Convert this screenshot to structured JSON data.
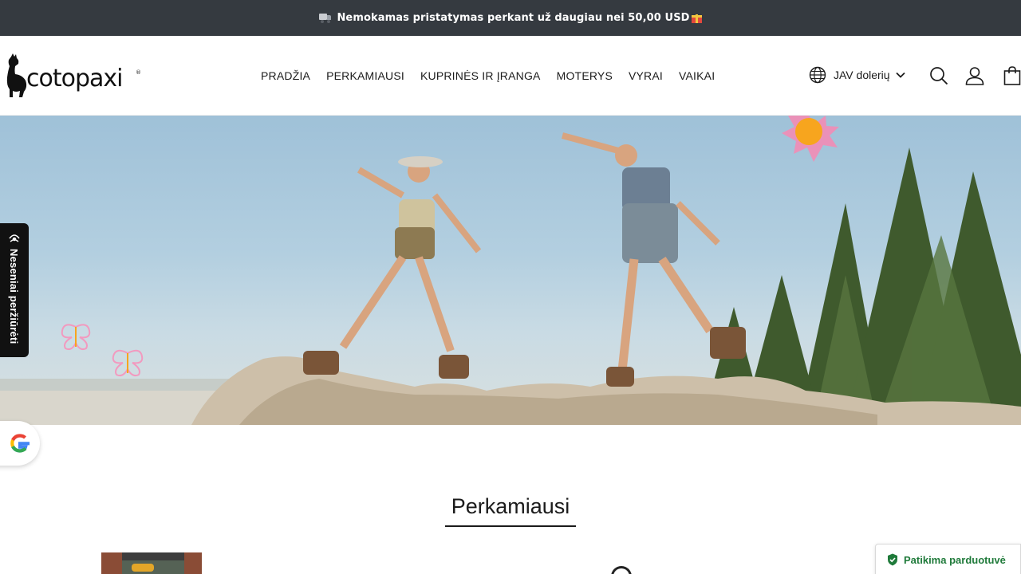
{
  "announcement": {
    "text": "Nemokamas pristatymas perkant už daugiau nei 50,00 USD"
  },
  "brand": {
    "name": "cotopaxi",
    "registered": "®"
  },
  "nav": {
    "items": [
      "PRADŽIA",
      "PERKAMIAUSI",
      "KUPRINĖS IR ĮRANGA",
      "MOTERYS",
      "VYRAI",
      "VAIKAI"
    ]
  },
  "currency": {
    "label": "JAV dolerių"
  },
  "recently_viewed": {
    "label": "Neseniai peržiūrėti"
  },
  "section": {
    "title": "Perkamiausi"
  },
  "trust_badge": {
    "label": "Patikima parduotuvė"
  },
  "colors": {
    "announce_bg": "#353a40",
    "trusted_green": "#1f7a3a",
    "text": "#1b1b1b"
  },
  "icons": [
    "truck-icon",
    "gift-icon",
    "globe-icon",
    "chevron-down-icon",
    "search-icon",
    "account-icon",
    "cart-icon",
    "recent-eye-icon",
    "google-icon",
    "shield-check-icon"
  ]
}
